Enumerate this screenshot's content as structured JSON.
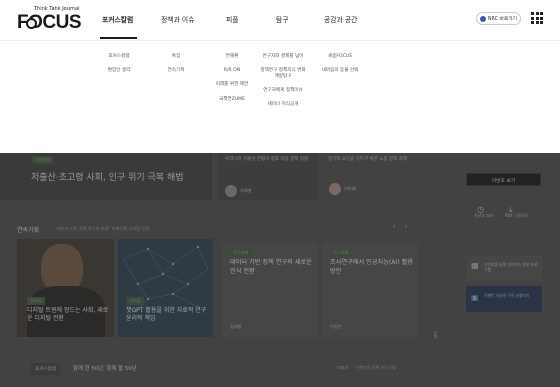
{
  "brand": {
    "tagline": "Think Tank Journal",
    "wordmark": "FOCUS"
  },
  "gnb": {
    "items": [
      "포커스칼럼",
      "정책과 이슈",
      "피플",
      "탐구",
      "공감과 공간"
    ],
    "active_index": 0
  },
  "header_actions": {
    "nrc_label": "NRC 바로가기"
  },
  "megamenu": {
    "columns": [
      [
        "포커스칼럼",
        "편집인 생각"
      ],
      [
        "특집",
        "연속기획"
      ],
      [
        "연재편",
        "R/R ON",
        "미래를 위한 제언",
        "국책연ZUME"
      ],
      [
        "연구자와 경제를 넘어",
        "정책연구 정책지식 변화계량탐구",
        "연구자에게 정책이슈",
        "세미나 지식공개"
      ],
      [
        "세종FOCUS",
        "내마음의 등불 선택"
      ]
    ]
  },
  "dimmed_page": {
    "hero_badge": "이달칼럼",
    "hero_title": "저출산·초고령 사회, 인구 위기 극복 해법",
    "mid_title": "우리나라 저출산 현황과 향후 대응 정책 방향",
    "mid_author": "하혜영",
    "right_title": "장기적 요인을 가두기 위한 노동 정책 과제",
    "right_author": "이다혜",
    "sidebar_button": "이번호 보기",
    "sidebar_icons": [
      "지난호 보기",
      "PDF 다운로드"
    ],
    "series_label": "연속기획",
    "series_sub": "\"데이터 기반 정책 연구의 미래\" 특별기획 디지털 전환",
    "cards": [
      {
        "badge": "인터뷰",
        "title": "디지털 트윈에 정드는 사회, 새로운 디지털 전환"
      },
      {
        "badge": "인터뷰",
        "title": "챗GPT 활용을 위한 자료적 연구윤리적 책임"
      },
      {
        "badge": "연구과제",
        "title": "데이터 기반 정책 연구의 새로운 인식 전환",
        "author": "김대홍"
      },
      {
        "badge": "연구과제",
        "title": "조사연구에서 인공지능(AI) 활용 방안",
        "author": "이정민"
      }
    ],
    "sidebar_notice": "이번호를 통해 알아보는 정보 프로그램",
    "sidebar_promo": "이벤트 이달의 구독 신청하기",
    "bottom_badge": "포커스칼럼",
    "bottom_title": "함께 한 50년, 함께 할 50년",
    "bottom_more": "더보기",
    "bottom_tag": "이번호의 정책 이슈 모음",
    "vertical_label": "TOP"
  },
  "colors": {
    "header_bg": "#ffffff",
    "overlay": "#424242",
    "badge_green": "#5f7d59"
  }
}
